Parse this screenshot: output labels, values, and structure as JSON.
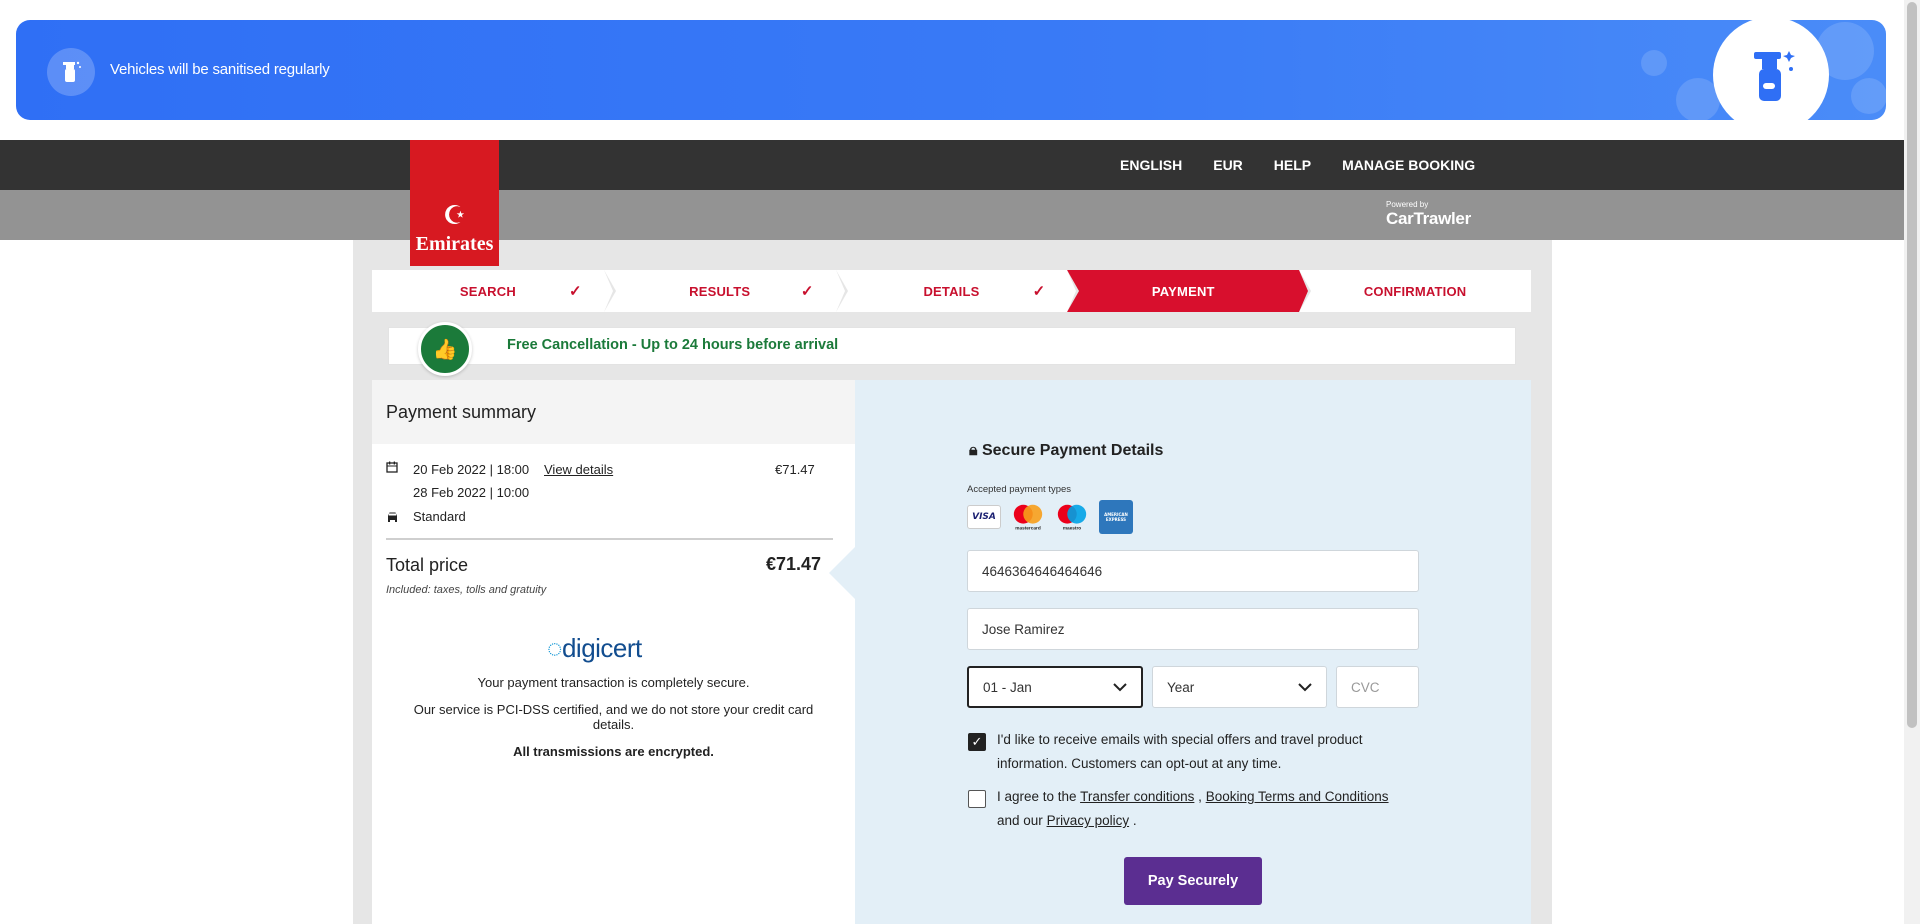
{
  "banner": {
    "message": "Vehicles will be sanitised regularly",
    "icon": "spray-bottle-icon"
  },
  "header": {
    "logo_script": "☪︎",
    "logo_text": "Emirates",
    "nav": [
      "ENGLISH",
      "EUR",
      "HELP",
      "MANAGE BOOKING"
    ],
    "powered_by": "Powered by",
    "brand": "CarTrawler"
  },
  "steps": [
    {
      "label": "SEARCH",
      "done": true
    },
    {
      "label": "RESULTS",
      "done": true
    },
    {
      "label": "DETAILS",
      "done": true
    },
    {
      "label": "PAYMENT",
      "active": true
    },
    {
      "label": "CONFIRMATION"
    }
  ],
  "free_cancel": "Free Cancellation - Up to 24 hours before arrival",
  "summary": {
    "title": "Payment summary",
    "pickup": "20 Feb 2022 | 18:00",
    "view_details": "View details",
    "price_line": "€71.47",
    "dropoff": "28 Feb 2022 | 10:00",
    "car_class": "Standard",
    "total_label": "Total price",
    "total_value": "€71.47",
    "included": "Included: taxes, tolls and gratuity",
    "digicert": "digicert",
    "secure1": "Your payment transaction is completely secure.",
    "secure2": "Our service is PCI-DSS certified, and we do not store your credit card details.",
    "secure3": "All transmissions are encrypted."
  },
  "payment": {
    "title": "Secure Payment Details",
    "accepted": "Accepted payment types",
    "cards": [
      "VISA",
      "mastercard",
      "maestro",
      "AMERICAN EXPRESS"
    ],
    "card_number": "4646364646464646",
    "card_name": "Jose Ramirez",
    "month": "01 - Jan",
    "year": "Year",
    "cvc_placeholder": "CVC",
    "optin_text": "I'd like to receive emails with special offers and travel product information. Customers can opt-out at any time.",
    "optin_checked": true,
    "terms_prefix": "I agree to the",
    "transfer_link": "Transfer conditions",
    "comma": ",",
    "booking_link": "Booking Terms and Conditions",
    "and_our": "and our",
    "privacy_link": "Privacy policy",
    "period": ".",
    "pay_button": "Pay Securely"
  }
}
